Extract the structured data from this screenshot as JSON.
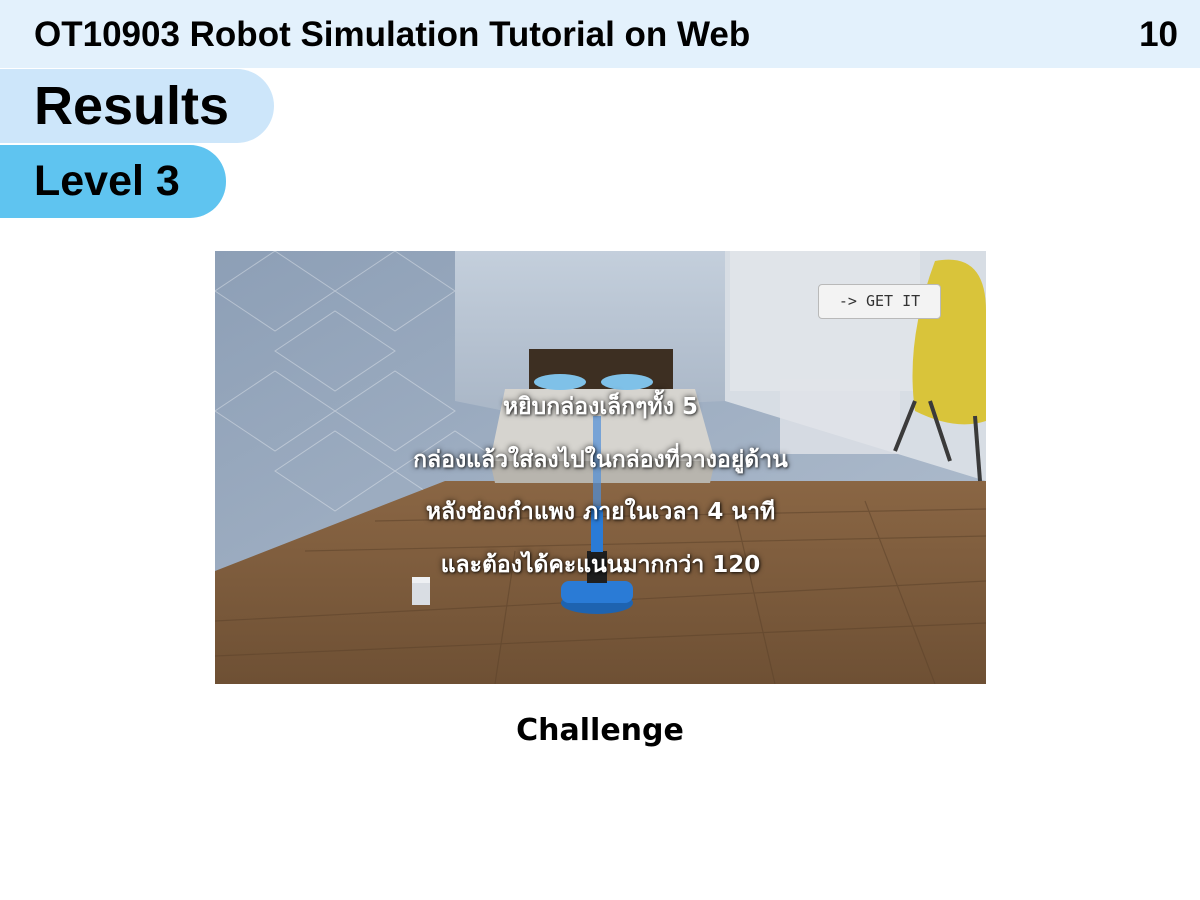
{
  "header": {
    "course_title": "OT10903 Robot Simulation Tutorial on Web",
    "page_number": "10"
  },
  "section": {
    "title": "Results",
    "subtitle": "Level 3"
  },
  "simulation": {
    "button_label": "-> GET IT",
    "instructions": [
      "หยิบกล่องเล็กๆทั้ง 5",
      "กล่องแล้วใส่ลงไปในกล่องที่วางอยู่ด้าน",
      "หลังช่องกำแพง ภายในเวลา 4 นาที",
      "และต้องได้คะแนนมากกว่า 120"
    ]
  },
  "caption": "Challenge",
  "colors": {
    "header_bar": "#e3f1fc",
    "results_pill": "#cde6fa",
    "level_pill": "#5fc4f0",
    "floor": "#7e5c3b",
    "wall": "#9eaec3",
    "chair": "#d9c43a",
    "robot": "#2a7bd6"
  },
  "icons": [
    "arrow-right-icon"
  ]
}
